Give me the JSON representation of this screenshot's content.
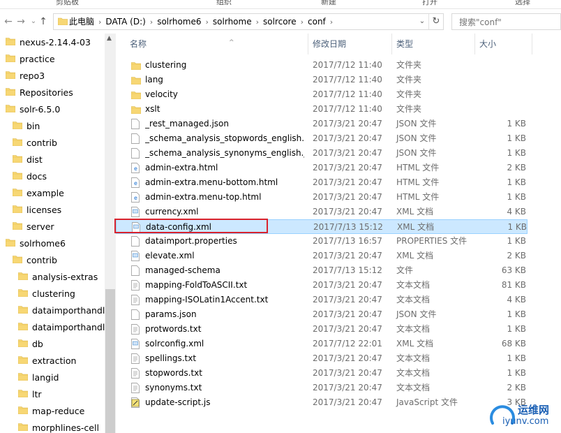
{
  "ribbon": {
    "groups": [
      "剪贴板",
      "组织",
      "新建",
      "打开",
      "选择"
    ]
  },
  "nav": {
    "back": "←",
    "forward": "→",
    "dropdown": "⌄",
    "up": "↑"
  },
  "address": {
    "crumbs": [
      "此电脑",
      "DATA (D:)",
      "solrhome6",
      "solrhome",
      "solrcore",
      "conf"
    ],
    "sep": "›",
    "dropdown": "⌄",
    "refresh": "↻"
  },
  "search": {
    "placeholder": "搜索\"conf\""
  },
  "sidebar": {
    "items": [
      {
        "label": "nexus-2.14.4-03",
        "level": 0
      },
      {
        "label": "practice",
        "level": 0
      },
      {
        "label": "repo3",
        "level": 0
      },
      {
        "label": "Repositories",
        "level": 0
      },
      {
        "label": "solr-6.5.0",
        "level": 0
      },
      {
        "label": "bin",
        "level": 1
      },
      {
        "label": "contrib",
        "level": 1
      },
      {
        "label": "dist",
        "level": 1
      },
      {
        "label": "docs",
        "level": 1
      },
      {
        "label": "example",
        "level": 1
      },
      {
        "label": "licenses",
        "level": 1
      },
      {
        "label": "server",
        "level": 1
      },
      {
        "label": "solrhome6",
        "level": 0
      },
      {
        "label": "contrib",
        "level": 1
      },
      {
        "label": "analysis-extras",
        "level": 2
      },
      {
        "label": "clustering",
        "level": 2
      },
      {
        "label": "dataimporthandle",
        "level": 2
      },
      {
        "label": "dataimporthandle",
        "level": 2
      },
      {
        "label": "db",
        "level": 2
      },
      {
        "label": "extraction",
        "level": 2
      },
      {
        "label": "langid",
        "level": 2
      },
      {
        "label": "ltr",
        "level": 2
      },
      {
        "label": "map-reduce",
        "level": 2
      },
      {
        "label": "morphlines-cell",
        "level": 2
      }
    ]
  },
  "columns": {
    "name": "名称",
    "date": "修改日期",
    "type": "类型",
    "size": "大小",
    "sort_indicator": "^"
  },
  "files": [
    {
      "name": "clustering",
      "date": "2017/7/12 11:40",
      "type": "文件夹",
      "size": "",
      "icon": "folder"
    },
    {
      "name": "lang",
      "date": "2017/7/12 11:40",
      "type": "文件夹",
      "size": "",
      "icon": "folder"
    },
    {
      "name": "velocity",
      "date": "2017/7/12 11:40",
      "type": "文件夹",
      "size": "",
      "icon": "folder"
    },
    {
      "name": "xslt",
      "date": "2017/7/12 11:40",
      "type": "文件夹",
      "size": "",
      "icon": "folder"
    },
    {
      "name": "_rest_managed.json",
      "date": "2017/3/21 20:47",
      "type": "JSON 文件",
      "size": "1 KB",
      "icon": "doc"
    },
    {
      "name": "_schema_analysis_stopwords_english....",
      "date": "2017/3/21 20:47",
      "type": "JSON 文件",
      "size": "1 KB",
      "icon": "doc"
    },
    {
      "name": "_schema_analysis_synonyms_english.j...",
      "date": "2017/3/21 20:47",
      "type": "JSON 文件",
      "size": "1 KB",
      "icon": "doc"
    },
    {
      "name": "admin-extra.html",
      "date": "2017/3/21 20:47",
      "type": "HTML 文件",
      "size": "2 KB",
      "icon": "html"
    },
    {
      "name": "admin-extra.menu-bottom.html",
      "date": "2017/3/21 20:47",
      "type": "HTML 文件",
      "size": "1 KB",
      "icon": "html"
    },
    {
      "name": "admin-extra.menu-top.html",
      "date": "2017/3/21 20:47",
      "type": "HTML 文件",
      "size": "1 KB",
      "icon": "html"
    },
    {
      "name": "currency.xml",
      "date": "2017/3/21 20:47",
      "type": "XML 文档",
      "size": "4 KB",
      "icon": "xml"
    },
    {
      "name": "data-config.xml",
      "date": "2017/7/13 15:12",
      "type": "XML 文档",
      "size": "1 KB",
      "icon": "xml",
      "selected": true
    },
    {
      "name": "dataimport.properties",
      "date": "2017/7/13 16:57",
      "type": "PROPERTIES 文件",
      "size": "1 KB",
      "icon": "doc"
    },
    {
      "name": "elevate.xml",
      "date": "2017/3/21 20:47",
      "type": "XML 文档",
      "size": "2 KB",
      "icon": "xml"
    },
    {
      "name": "managed-schema",
      "date": "2017/7/13 15:12",
      "type": "文件",
      "size": "63 KB",
      "icon": "doc"
    },
    {
      "name": "mapping-FoldToASCII.txt",
      "date": "2017/3/21 20:47",
      "type": "文本文档",
      "size": "81 KB",
      "icon": "txt"
    },
    {
      "name": "mapping-ISOLatin1Accent.txt",
      "date": "2017/3/21 20:47",
      "type": "文本文档",
      "size": "4 KB",
      "icon": "txt"
    },
    {
      "name": "params.json",
      "date": "2017/3/21 20:47",
      "type": "JSON 文件",
      "size": "1 KB",
      "icon": "doc"
    },
    {
      "name": "protwords.txt",
      "date": "2017/3/21 20:47",
      "type": "文本文档",
      "size": "1 KB",
      "icon": "txt"
    },
    {
      "name": "solrconfig.xml",
      "date": "2017/7/12 22:01",
      "type": "XML 文档",
      "size": "68 KB",
      "icon": "xml"
    },
    {
      "name": "spellings.txt",
      "date": "2017/3/21 20:47",
      "type": "文本文档",
      "size": "1 KB",
      "icon": "txt"
    },
    {
      "name": "stopwords.txt",
      "date": "2017/3/21 20:47",
      "type": "文本文档",
      "size": "1 KB",
      "icon": "txt"
    },
    {
      "name": "synonyms.txt",
      "date": "2017/3/21 20:47",
      "type": "文本文档",
      "size": "2 KB",
      "icon": "txt"
    },
    {
      "name": "update-script.js",
      "date": "2017/3/21 20:47",
      "type": "JavaScript 文件",
      "size": "3 KB",
      "icon": "js"
    }
  ],
  "watermark": {
    "cn": "运维网",
    "url": "iyunv.com"
  },
  "colors": {
    "selection": "#cce8ff",
    "highlight_box": "#d9232d",
    "folder": "#f7d774"
  }
}
